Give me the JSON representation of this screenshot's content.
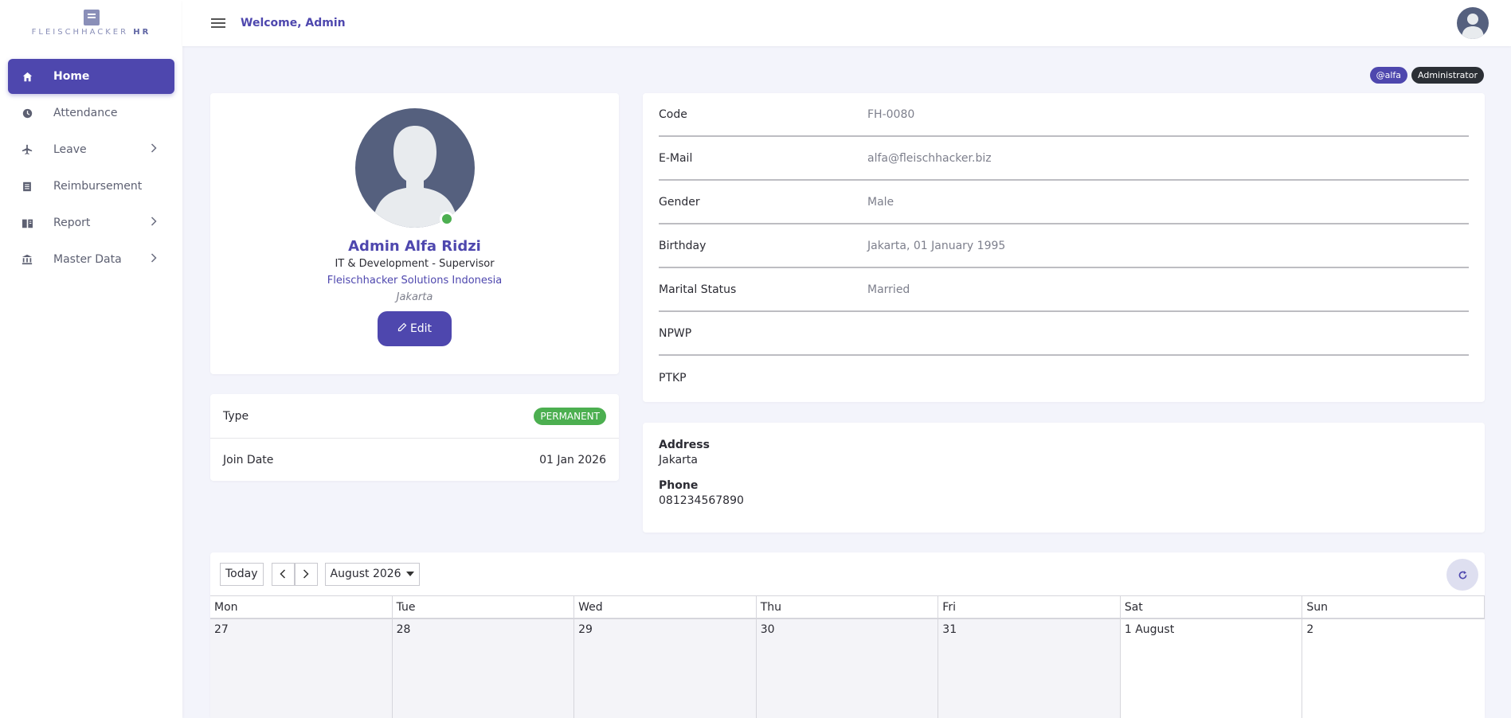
{
  "app": {
    "logo_word": "FLEISCHHACKER",
    "logo_suffix": "HR"
  },
  "sidebar": {
    "items": [
      {
        "label": "Home",
        "icon": "home-icon"
      },
      {
        "label": "Attendance",
        "icon": "clock-icon"
      },
      {
        "label": "Leave",
        "icon": "plane-icon"
      },
      {
        "label": "Reimbursement",
        "icon": "receipt-icon"
      },
      {
        "label": "Report",
        "icon": "book-icon"
      },
      {
        "label": "Master Data",
        "icon": "bank-icon"
      }
    ]
  },
  "header": {
    "welcome": "Welcome, Admin"
  },
  "badges": {
    "username": "@alfa",
    "role": "Administrator"
  },
  "profile": {
    "name": "Admin Alfa Ridzi",
    "position": "IT & Development - Supervisor",
    "company": "Fleischhacker Solutions Indonesia",
    "city": "Jakarta",
    "edit_label": "Edit",
    "status_color": "#4caf50"
  },
  "employment": {
    "type_label": "Type",
    "type_value": "PERMANENT",
    "join_label": "Join Date",
    "join_value": "01 Jan 2026"
  },
  "info": {
    "rows": [
      {
        "label": "Code",
        "value": "FH-0080"
      },
      {
        "label": "E-Mail",
        "value": "alfa@fleischhacker.biz"
      },
      {
        "label": "Gender",
        "value": "Male"
      },
      {
        "label": "Birthday",
        "value": "Jakarta, 01 January 1995"
      },
      {
        "label": "Marital Status",
        "value": "Married"
      },
      {
        "label": "NPWP",
        "value": ""
      },
      {
        "label": "PTKP",
        "value": ""
      }
    ]
  },
  "contact": {
    "address_label": "Address",
    "address_value": "Jakarta",
    "phone_label": "Phone",
    "phone_value": "081234567890"
  },
  "calendar": {
    "today_label": "Today",
    "month_label": "August 2026",
    "days": [
      "Mon",
      "Tue",
      "Wed",
      "Thu",
      "Fri",
      "Sat",
      "Sun"
    ],
    "dates": [
      "27",
      "28",
      "29",
      "30",
      "31",
      "1 August",
      "2"
    ]
  },
  "colors": {
    "primary": "#4e47ae",
    "success": "#4caf50",
    "dark_badge": "#2b2f35"
  }
}
